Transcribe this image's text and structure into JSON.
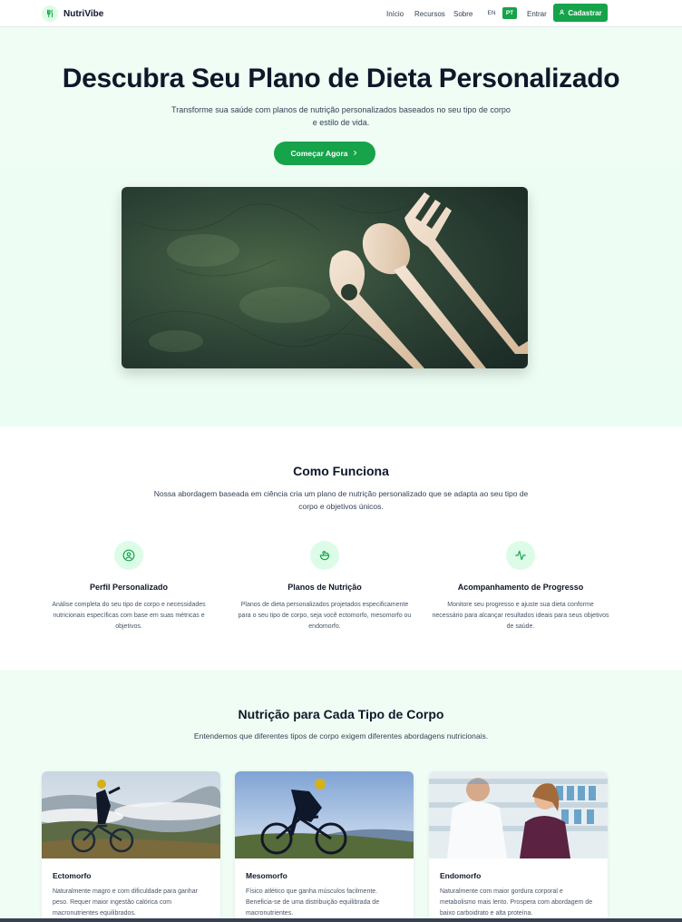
{
  "header": {
    "brand": "NutriVibe",
    "nav": [
      "Início",
      "Recursos",
      "Sobre"
    ],
    "lang_en": "EN",
    "lang_pt": "PT",
    "login": "Entrar",
    "signup": "Cadastrar"
  },
  "hero": {
    "title": "Descubra Seu Plano de Dieta Personalizado",
    "subtitle": "Transforme sua saúde com planos de nutrição personalizados baseados no seu tipo de corpo e estilo de vida.",
    "cta": "Começar Agora"
  },
  "how": {
    "title": "Como Funciona",
    "subtitle": "Nossa abordagem baseada em ciência cria um plano de nutrição personalizado que se adapta ao seu tipo de corpo e objetivos únicos.",
    "features": [
      {
        "icon": "user-circle-icon",
        "title": "Perfil Personalizado",
        "desc": "Análise completa do seu tipo de corpo e necessidades nutricionais específicas com base em suas métricas e objetivos."
      },
      {
        "icon": "salad-icon",
        "title": "Planos de Nutrição",
        "desc": "Planos de dieta personalizados projetados especificamente para o seu tipo de corpo, seja você ectomorfo, mesomorfo ou endomorfo."
      },
      {
        "icon": "activity-icon",
        "title": "Acompanhamento de Progresso",
        "desc": "Monitore seu progresso e ajuste sua dieta conforme necessário para alcançar resultados ideais para seus objetivos de saúde."
      }
    ]
  },
  "types": {
    "title": "Nutrição para Cada Tipo de Corpo",
    "subtitle": "Entendemos que diferentes tipos de corpo exigem diferentes abordagens nutricionais.",
    "cards": [
      {
        "title": "Ectomorfo",
        "desc": "Naturalmente magro e com dificuldade para ganhar peso. Requer maior ingestão calórica com macronutrientes equilibrados."
      },
      {
        "title": "Mesomorfo",
        "desc": "Físico atlético que ganha músculos facilmente. Beneficia-se de uma distribuição equilibrada de macronutrientes."
      },
      {
        "title": "Endomorfo",
        "desc": "Naturalmente com maior gordura corporal e metabolismo mais lento. Prospera com abordagem de baixo carboidrato e alta proteína."
      }
    ]
  },
  "colors": {
    "accent": "#16a34a",
    "light_green": "#f0fdf4",
    "icon_bg": "#dcfce7"
  }
}
